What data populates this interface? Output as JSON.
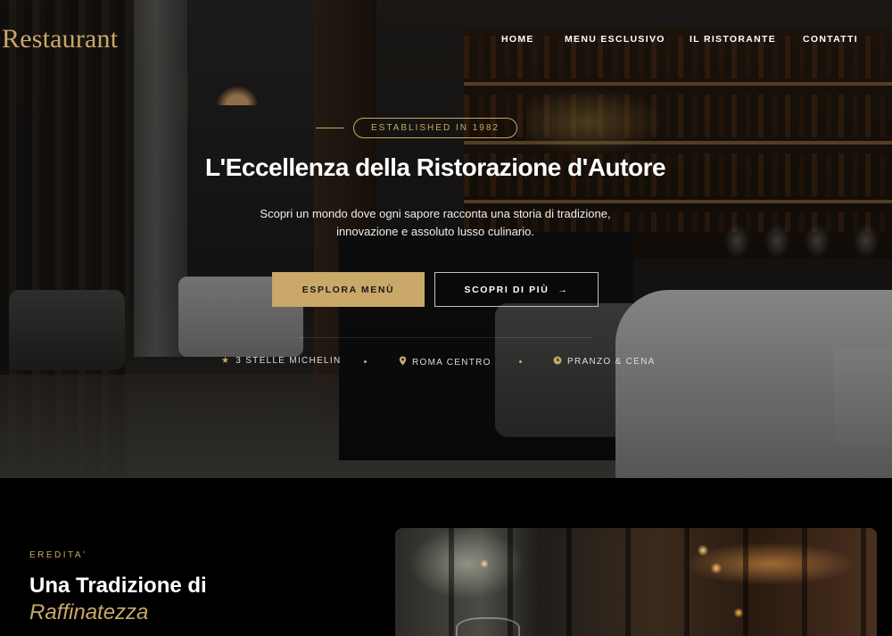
{
  "brand": "Restaurant",
  "nav": [
    "HOME",
    "MENU ESCLUSIVO",
    "IL RISTORANTE",
    "CONTATTI"
  ],
  "hero": {
    "badge": "ESTABLISHED IN 1982",
    "title": "L'Eccellenza della Ristorazione d'Autore",
    "subtitle_line1": "Scopri un mondo dove ogni sapore racconta una storia di tradizione,",
    "subtitle_line2": "innovazione e assoluto lusso culinario.",
    "primary_button": "ESPLORA MENÙ",
    "secondary_button": "SCOPRI DI PIÙ",
    "secondary_arrow": "→",
    "features": [
      {
        "icon": "star-icon",
        "glyph": "★",
        "label": "3 STELLE MICHELIN"
      },
      {
        "icon": "location-pin-icon",
        "glyph": "⬤",
        "label": "ROMA CENTRO"
      },
      {
        "icon": "clock-icon",
        "glyph": "◷",
        "label": "PRANZO & CENA"
      }
    ]
  },
  "section2": {
    "eyebrow": "EREDITA'",
    "title": "Una Tradizione di",
    "title_accent": "Raffinatezza"
  },
  "colors": {
    "accent_gold": "#c9a869",
    "background": "#000000",
    "text": "#ffffff"
  }
}
